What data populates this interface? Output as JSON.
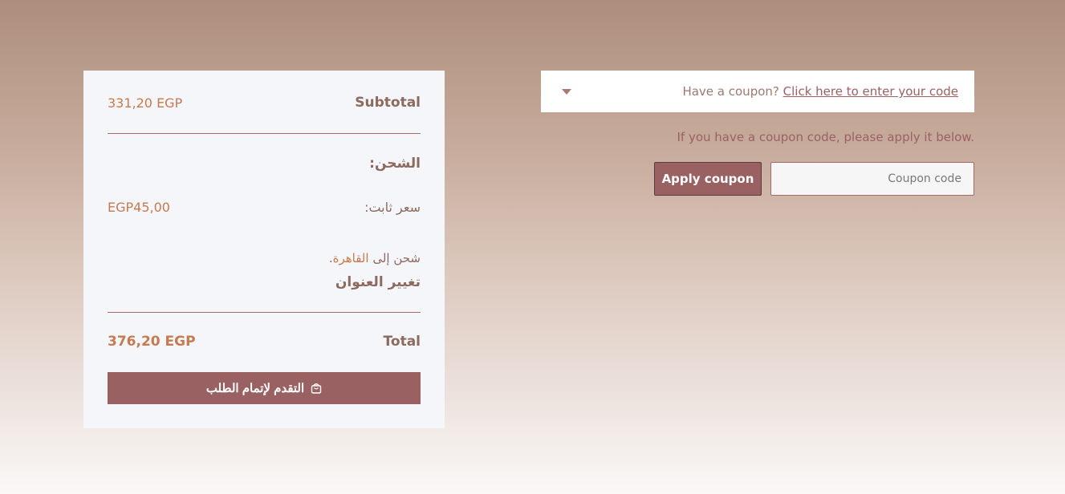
{
  "cart_totals": {
    "subtotal_label": "Subtotal",
    "subtotal_value": "331,20 EGP",
    "shipping_title": "الشحن:",
    "flat_rate_label": "سعر ثابت:",
    "flat_rate_value": "EGP45,00",
    "ship_to_prefix": "شحن إلى ",
    "ship_to_city": "القاهرة",
    "ship_to_suffix": ".",
    "change_address": "تغيير العنوان",
    "total_label": "Total",
    "total_value": "376,20 EGP",
    "checkout_button": "التقدم لإتمام الطلب"
  },
  "coupon": {
    "toggle_text": "Have a coupon?",
    "toggle_link": "Click here to enter your code",
    "hint": "If you have a coupon code, please apply it below.",
    "input_placeholder": "Coupon code",
    "apply_button": "Apply coupon"
  },
  "icons": {
    "checkout": "shopping-bag-icon",
    "toggle": "caret-down-icon"
  },
  "colors": {
    "accent": "#9a6163",
    "price": "#c57a52",
    "text": "#8c6a5d",
    "panel": "#f5f6fa"
  }
}
